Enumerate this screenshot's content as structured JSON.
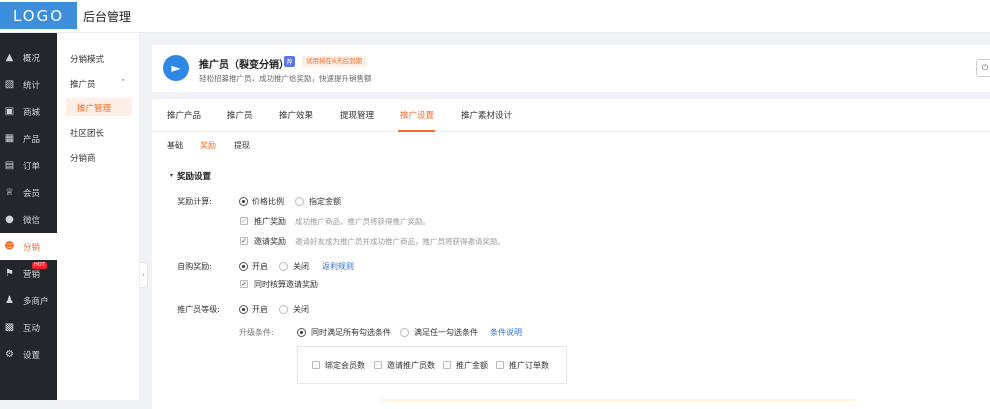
{
  "topbar": {
    "logo": "LOGO",
    "title": "后台管理"
  },
  "sidebar": {
    "items": [
      {
        "label": "概况",
        "icon": "graduation-icon"
      },
      {
        "label": "统计",
        "icon": "chart-icon"
      },
      {
        "label": "商城",
        "icon": "store-icon"
      },
      {
        "label": "产品",
        "icon": "grid-icon"
      },
      {
        "label": "订单",
        "icon": "order-icon"
      },
      {
        "label": "会员",
        "icon": "crown-icon"
      },
      {
        "label": "微信",
        "icon": "wechat-icon"
      },
      {
        "label": "分销",
        "icon": "user-share-icon"
      },
      {
        "label": "营销",
        "icon": "flag-icon",
        "badge": "HOT"
      },
      {
        "label": "多商户",
        "icon": "users-icon"
      },
      {
        "label": "互动",
        "icon": "apps-icon"
      },
      {
        "label": "设置",
        "icon": "gear-icon"
      }
    ]
  },
  "submenu": {
    "mode": "分销模式",
    "promoter": "推广员",
    "promo_manage": "推广管理",
    "community": "社区团长",
    "distributor": "分销商"
  },
  "header": {
    "title": "推广员（裂变分销）",
    "badge": "荐",
    "trial": "试用将在6天后到期",
    "desc": "轻松招募推广员，成功推广给奖励，快速提升销售额"
  },
  "tabs": [
    "推广产品",
    "推广员",
    "推广效果",
    "提现管理",
    "推广设置",
    "推广素材设计"
  ],
  "subtabs": [
    "基础",
    "奖励",
    "提现"
  ],
  "section": {
    "title": "奖励设置"
  },
  "form": {
    "reward_calc": {
      "label": "奖励计算:",
      "opt1": "价格比例",
      "opt2": "指定金额",
      "promo_reward": "推广奖励",
      "promo_reward_desc": "成功推广商品，推广员将获得推广奖励。",
      "invite_reward": "邀请奖励",
      "invite_reward_desc": "邀请好友成为推广员并成功推广商品，推广员将获得邀请奖励。"
    },
    "self_reward": {
      "label": "自购奖励:",
      "on": "开启",
      "off": "关闭",
      "link": "返利规则",
      "also_calc": "同时核算邀请奖励"
    },
    "level": {
      "label": "推广员等级:",
      "on": "开启",
      "off": "关闭",
      "upgrade_label": "升级条件:",
      "opt_all": "同时满足所有勾选条件",
      "opt_any": "满足任一勾选条件",
      "cond_link": "条件说明",
      "conds": [
        "绑定会员数",
        "邀请推广员数",
        "推广金额",
        "推广订单数"
      ]
    }
  }
}
